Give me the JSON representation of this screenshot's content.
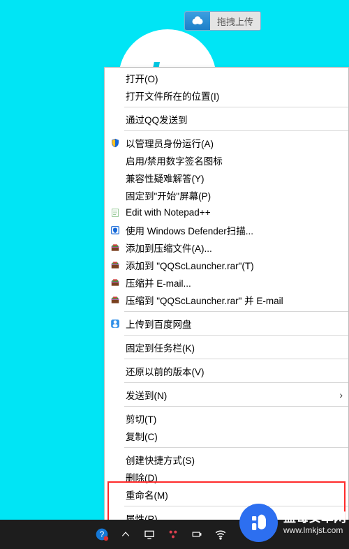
{
  "float_upload": {
    "label": "拖拽上传"
  },
  "menu": {
    "items": [
      {
        "label": "打开(O)"
      },
      {
        "label": "打开文件所在的位置(I)"
      },
      "sep",
      {
        "label": "通过QQ发送到"
      },
      "sep",
      {
        "label": "以管理员身份运行(A)",
        "icon": "shield"
      },
      {
        "label": "启用/禁用数字签名图标"
      },
      {
        "label": "兼容性疑难解答(Y)"
      },
      {
        "label": "固定到\"开始\"屏幕(P)"
      },
      {
        "label": "Edit with Notepad++",
        "icon": "notepad"
      },
      {
        "label": "使用 Windows Defender扫描...",
        "icon": "defender"
      },
      {
        "label": "添加到压缩文件(A)...",
        "icon": "winrar"
      },
      {
        "label": "添加到 \"QQScLauncher.rar\"(T)",
        "icon": "winrar"
      },
      {
        "label": "压缩并 E-mail...",
        "icon": "winrar"
      },
      {
        "label": "压缩到 \"QQScLauncher.rar\" 并 E-mail",
        "icon": "winrar"
      },
      "sep",
      {
        "label": "上传到百度网盘",
        "icon": "baidu"
      },
      "sep",
      {
        "label": "固定到任务栏(K)"
      },
      "sep",
      {
        "label": "还原以前的版本(V)"
      },
      "sep",
      {
        "label": "发送到(N)",
        "submenu": true
      },
      "sep",
      {
        "label": "剪切(T)"
      },
      {
        "label": "复制(C)"
      },
      "sep",
      {
        "label": "创建快捷方式(S)"
      },
      {
        "label": "删除(D)"
      },
      {
        "label": "重命名(M)"
      },
      "sep",
      {
        "label": "属性(R)"
      }
    ]
  },
  "watermark": {
    "title": "蓝莓安卓网",
    "url": "www.lmkjst.com"
  }
}
